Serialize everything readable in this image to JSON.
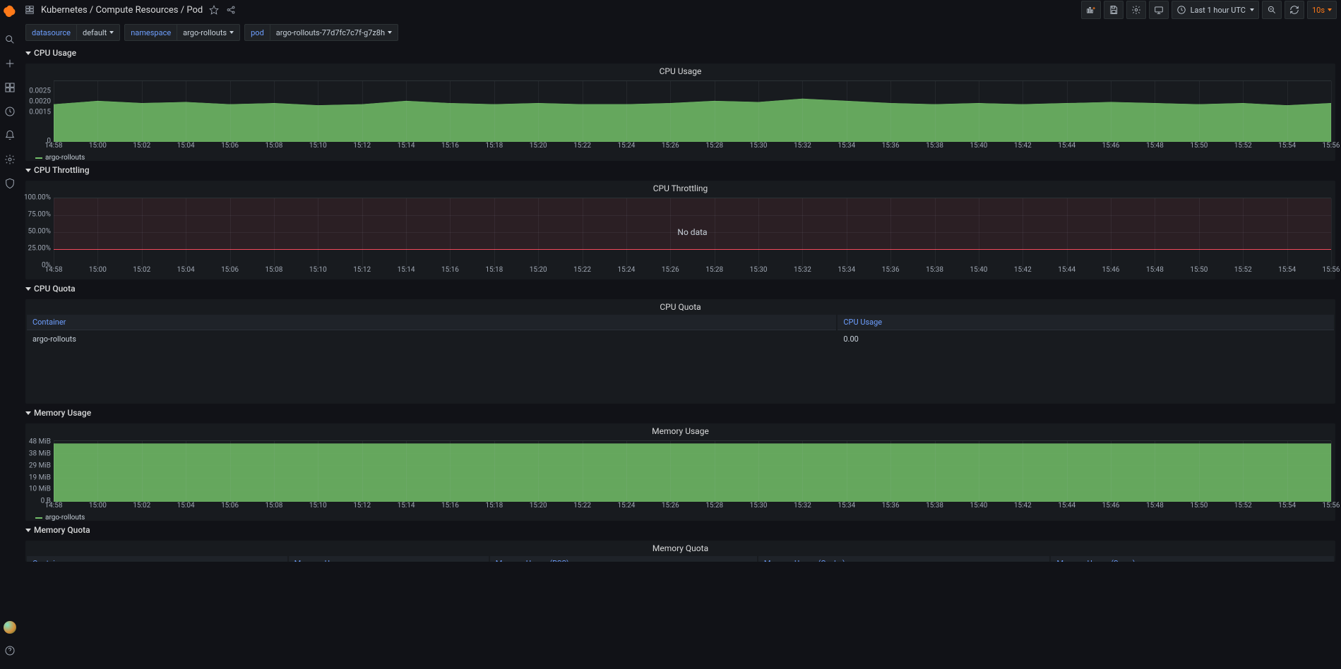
{
  "header": {
    "title": "Kubernetes / Compute Resources / Pod",
    "timepicker_label": "Last 1 hour UTC",
    "refresh_label": "10s"
  },
  "vars": {
    "datasource": {
      "label": "datasource",
      "value": "default"
    },
    "namespace": {
      "label": "namespace",
      "value": "argo-rollouts"
    },
    "pod": {
      "label": "pod",
      "value": "argo-rollouts-77d7fc7c7f-g7z8h"
    }
  },
  "rows": {
    "cpu_usage": "CPU Usage",
    "cpu_throttling": "CPU Throttling",
    "cpu_quota": "CPU Quota",
    "mem_usage": "Memory Usage",
    "mem_quota": "Memory Quota"
  },
  "legend": {
    "series": "argo-rollouts"
  },
  "nodata": "No data",
  "cpu_quota_table": {
    "col_container": "Container",
    "col_cpu_usage": "CPU Usage",
    "row_container": "argo-rollouts",
    "row_cpu_usage": "0.00"
  },
  "mem_quota_table": {
    "col_container": "Container",
    "col_mem_usage": "Memory Usage",
    "col_mem_rss": "Memory Usage (RSS)",
    "col_mem_cache": "Memory Usage (Cache)",
    "col_mem_swap": "Memory Usage (Swap)"
  },
  "chart_data": [
    {
      "id": "cpu_usage",
      "type": "area",
      "title": "CPU Usage",
      "xlabel": "",
      "ylabel": "",
      "ylim": [
        0,
        0.00275
      ],
      "yticks": [
        0,
        0.0015,
        0.002,
        0.0025
      ],
      "x": [
        "14:58",
        "15:00",
        "15:02",
        "15:04",
        "15:06",
        "15:08",
        "15:10",
        "15:12",
        "15:14",
        "15:16",
        "15:18",
        "15:20",
        "15:22",
        "15:24",
        "15:26",
        "15:28",
        "15:30",
        "15:32",
        "15:34",
        "15:36",
        "15:38",
        "15:40",
        "15:42",
        "15:44",
        "15:46",
        "15:48",
        "15:50",
        "15:52",
        "15:54",
        "15:56"
      ],
      "series": [
        {
          "name": "argo-rollouts",
          "color": "#73bf69",
          "values": [
            0.0017,
            0.00185,
            0.00175,
            0.0018,
            0.0017,
            0.00175,
            0.00165,
            0.0017,
            0.00185,
            0.00175,
            0.0017,
            0.00175,
            0.0017,
            0.0017,
            0.00175,
            0.00185,
            0.0018,
            0.00195,
            0.00185,
            0.00175,
            0.0017,
            0.00175,
            0.0017,
            0.00175,
            0.0018,
            0.00175,
            0.0017,
            0.00175,
            0.00165,
            0.00175
          ]
        }
      ]
    },
    {
      "id": "cpu_throttling",
      "type": "line",
      "title": "CPU Throttling",
      "ylim": [
        0,
        100
      ],
      "yticks_labels": [
        "0%",
        "25.00%",
        "50.00%",
        "75.00%",
        "100.00%"
      ],
      "yticks": [
        0,
        25,
        50,
        75,
        100
      ],
      "threshold": 25,
      "threshold_band": [
        25,
        100
      ],
      "x": [
        "14:58",
        "15:00",
        "15:02",
        "15:04",
        "15:06",
        "15:08",
        "15:10",
        "15:12",
        "15:14",
        "15:16",
        "15:18",
        "15:20",
        "15:22",
        "15:24",
        "15:26",
        "15:28",
        "15:30",
        "15:32",
        "15:34",
        "15:36",
        "15:38",
        "15:40",
        "15:42",
        "15:44",
        "15:46",
        "15:48",
        "15:50",
        "15:52",
        "15:54",
        "15:56"
      ],
      "series": [],
      "nodata": true
    },
    {
      "id": "memory_usage",
      "type": "area",
      "title": "Memory Usage",
      "ylim": [
        0,
        48
      ],
      "yunit": "MiB",
      "yticks_labels": [
        "0 B",
        "10 MiB",
        "19 MiB",
        "29 MiB",
        "38 MiB",
        "48 MiB"
      ],
      "yticks": [
        0,
        10,
        19,
        29,
        38,
        48
      ],
      "x": [
        "14:58",
        "15:00",
        "15:02",
        "15:04",
        "15:06",
        "15:08",
        "15:10",
        "15:12",
        "15:14",
        "15:16",
        "15:18",
        "15:20",
        "15:22",
        "15:24",
        "15:26",
        "15:28",
        "15:30",
        "15:32",
        "15:34",
        "15:36",
        "15:38",
        "15:40",
        "15:42",
        "15:44",
        "15:46",
        "15:48",
        "15:50",
        "15:52",
        "15:54",
        "15:56"
      ],
      "series": [
        {
          "name": "argo-rollouts",
          "color": "#73bf69",
          "values": [
            46,
            46,
            46,
            46,
            46,
            46,
            46,
            46,
            46,
            46,
            46,
            46,
            46,
            46,
            46,
            46,
            46,
            46,
            46,
            46,
            46,
            46,
            46,
            46,
            46,
            46,
            46,
            46,
            46,
            46
          ]
        }
      ]
    }
  ],
  "panel_titles": {
    "cpu_quota": "CPU Quota",
    "mem_quota": "Memory Quota"
  }
}
